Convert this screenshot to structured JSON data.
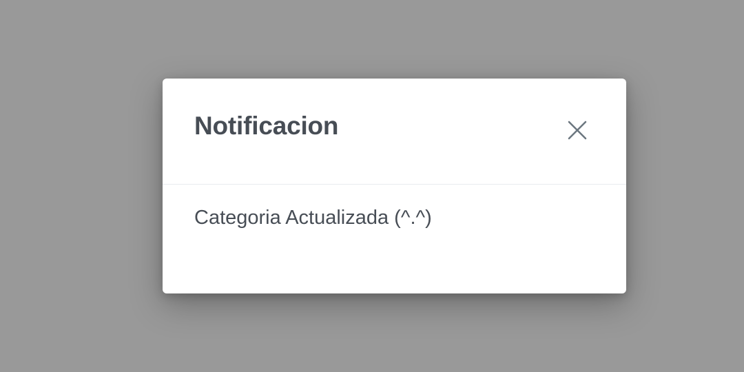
{
  "modal": {
    "title": "Notificacion",
    "message": "Categoria Actualizada (^.^)",
    "close_icon": "close-icon"
  },
  "colors": {
    "backdrop": "#999999",
    "modal_background": "#ffffff",
    "text": "#474d55",
    "divider": "#e9ecef",
    "close_icon": "#6c7780"
  }
}
